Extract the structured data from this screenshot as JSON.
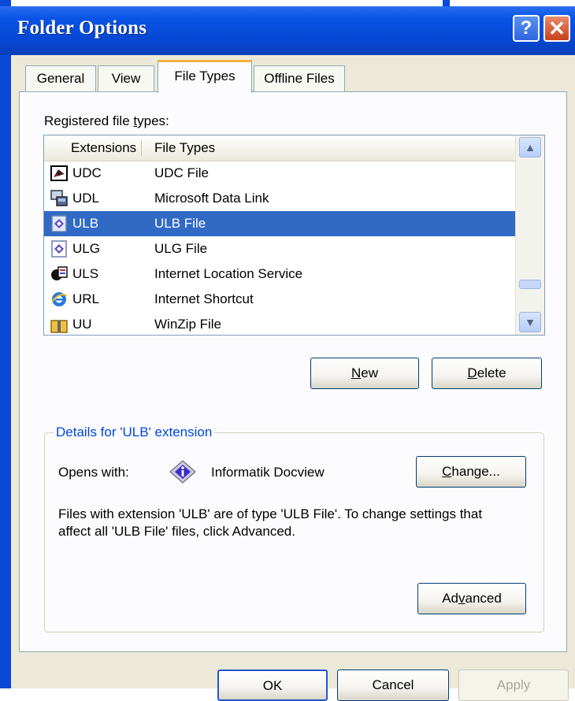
{
  "window": {
    "title": "Folder Options"
  },
  "tabs": [
    {
      "label": "General"
    },
    {
      "label": "View"
    },
    {
      "label": "File Types"
    },
    {
      "label": "Offline Files"
    }
  ],
  "registered": {
    "label_pre": "Registered file ",
    "label_ul": "t",
    "label_post": "ypes:"
  },
  "list": {
    "columns": [
      "Extensions",
      "File Types"
    ],
    "rows": [
      {
        "ext": "UDC",
        "type": "UDC File",
        "icon": "udc-file-icon"
      },
      {
        "ext": "UDL",
        "type": "Microsoft Data Link",
        "icon": "data-link-icon"
      },
      {
        "ext": "ULB",
        "type": "ULB File",
        "icon": "docview-icon",
        "selected": true
      },
      {
        "ext": "ULG",
        "type": "ULG File",
        "icon": "docview-icon"
      },
      {
        "ext": "ULS",
        "type": "Internet Location Service",
        "icon": "location-service-icon"
      },
      {
        "ext": "URL",
        "type": "Internet Shortcut",
        "icon": "ie-shortcut-icon"
      },
      {
        "ext": "UU",
        "type": "WinZip File",
        "icon": "winzip-icon"
      }
    ]
  },
  "buttons": {
    "new_ul": "N",
    "new_rest": "ew",
    "delete_ul": "D",
    "delete_rest": "elete",
    "change_ul": "C",
    "change_rest": "hange...",
    "advanced_pre": "Ad",
    "advanced_ul": "v",
    "advanced_post": "anced",
    "ok": "OK",
    "cancel": "Cancel",
    "apply": "Apply"
  },
  "details": {
    "legend": "Details for 'ULB' extension",
    "opens_with_label": "Opens with:",
    "app_name": "Informatik Docview",
    "description": "Files with extension 'ULB' are of type 'ULB File'.  To change settings that affect all 'ULB File' files, click Advanced."
  },
  "colors": {
    "title_blue": "#0a53e6",
    "selection": "#316ac5",
    "tab_highlight": "#f5b23f"
  }
}
